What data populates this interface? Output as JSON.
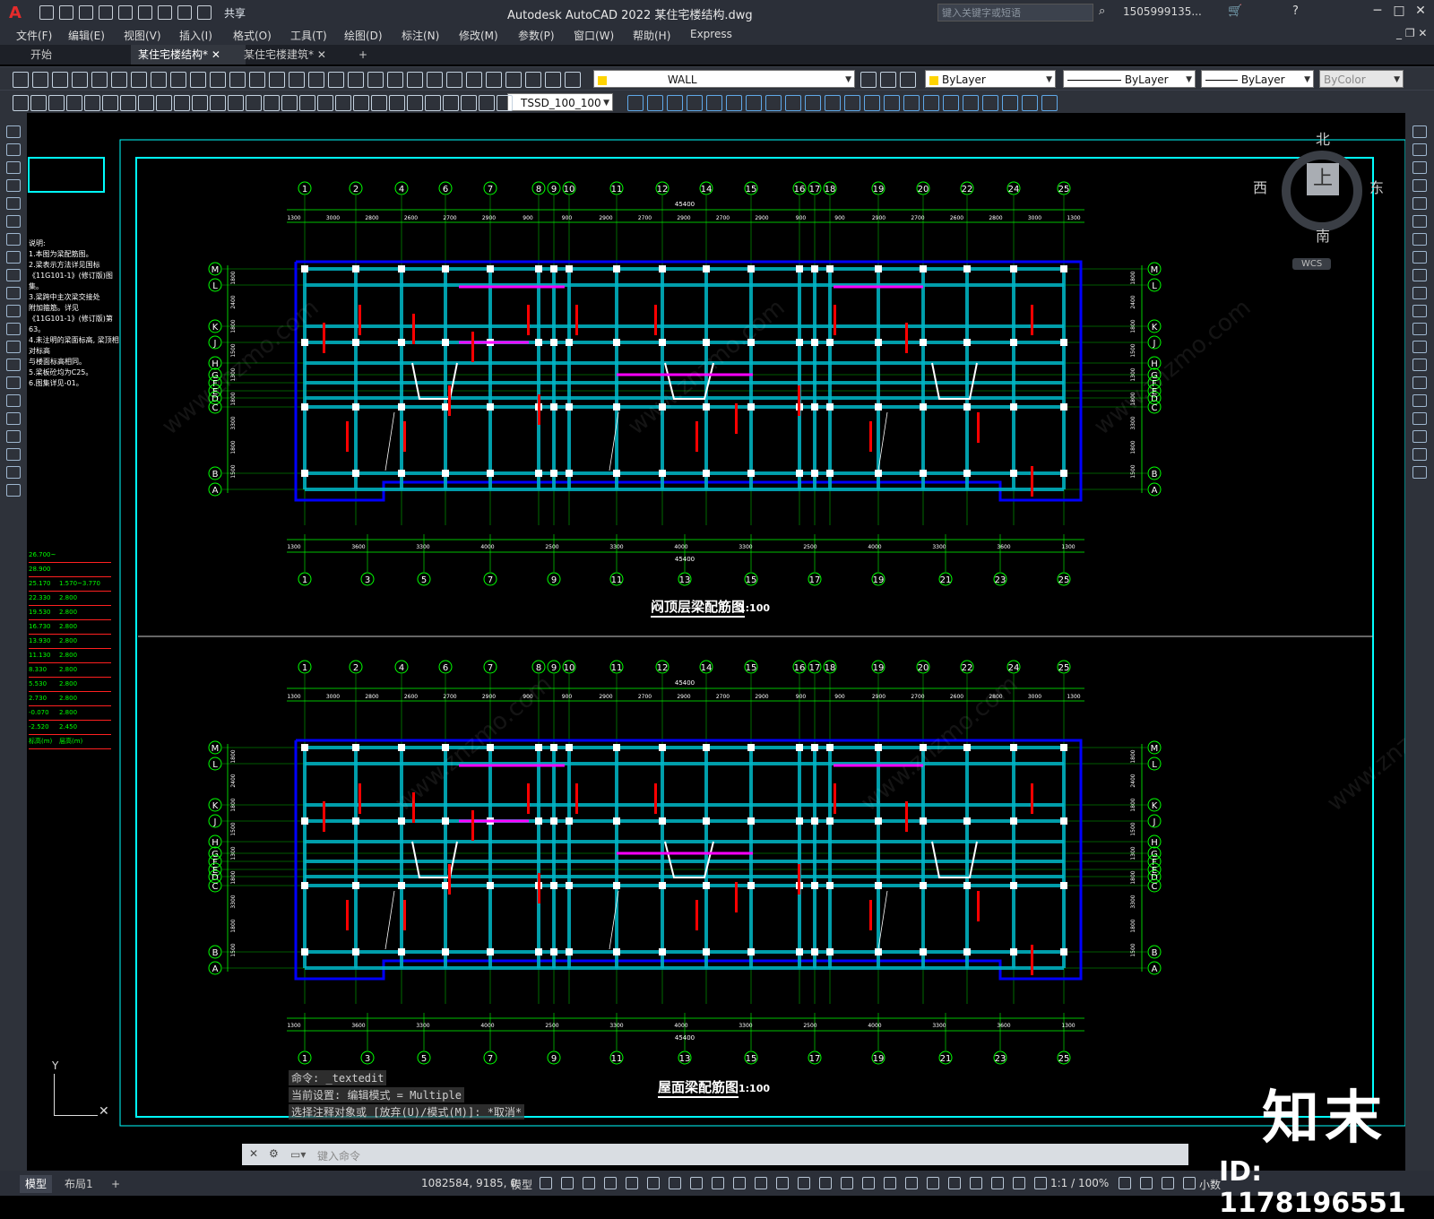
{
  "app": {
    "title": "Autodesk AutoCAD 2022    某住宅楼结构.dwg",
    "share_label": "共享",
    "search_placeholder": "键入关键字或短语",
    "user": "1505999135...",
    "logo": "A"
  },
  "menu": [
    "文件(F)",
    "编辑(E)",
    "视图(V)",
    "插入(I)",
    "格式(O)",
    "工具(T)",
    "绘图(D)",
    "标注(N)",
    "修改(M)",
    "参数(P)",
    "窗口(W)",
    "帮助(H)",
    "Express"
  ],
  "tabs": [
    {
      "label": "开始",
      "active": false
    },
    {
      "label": "某住宅楼结构*",
      "active": true
    },
    {
      "label": "某住宅楼建筑*",
      "active": false
    },
    {
      "label": "+",
      "active": false
    }
  ],
  "toolbar": {
    "layer": "WALL",
    "color": "ByLayer",
    "linetype": "ByLayer",
    "lineweight": "ByLayer",
    "plotstyle": "ByColor",
    "textstyle": "TSSD_100_100"
  },
  "viewcube": {
    "north": "北",
    "south": "南",
    "east": "东",
    "west": "西",
    "top": "上",
    "wcs": "WCS"
  },
  "drawing": {
    "plan1_title": "闷顶层梁配筋图",
    "plan2_title": "屋面梁配筋图",
    "scale": "1:100",
    "total_dim": "45400",
    "top_axes": [
      "1",
      "2",
      "4",
      "6",
      "7",
      "8",
      "9",
      "10",
      "11",
      "12",
      "14",
      "15",
      "16",
      "17",
      "18",
      "19",
      "20",
      "22",
      "24",
      "25"
    ],
    "bottom_axes": [
      "1",
      "3",
      "5",
      "7",
      "9",
      "11",
      "13",
      "15",
      "17",
      "19",
      "21",
      "23",
      "25"
    ],
    "row_axes": [
      "M",
      "L",
      "K",
      "J",
      "H",
      "G",
      "F",
      "E",
      "D",
      "C",
      "B",
      "A"
    ],
    "top_dims": [
      "1300",
      "3000",
      "2800",
      "2600",
      "2700",
      "2900",
      "900",
      "900",
      "2900",
      "2700",
      "2900",
      "2700",
      "2900",
      "900",
      "900",
      "2900",
      "2700",
      "2600",
      "2800",
      "3000",
      "1300"
    ],
    "bottom_dims": [
      "1300",
      "3600",
      "3300",
      "4000",
      "2500",
      "3300",
      "4000",
      "3300",
      "2500",
      "4000",
      "3300",
      "3600",
      "1300"
    ],
    "side_dims": [
      "1800",
      "2400",
      "1800",
      "1500",
      "1300",
      "1800",
      "3300",
      "1800",
      "1500"
    ],
    "level_table": [
      [
        "26.700~",
        ""
      ],
      [
        "28.900",
        ""
      ],
      [
        "25.170",
        "1.570~3.770"
      ],
      [
        "22.330",
        "2.800"
      ],
      [
        "19.530",
        "2.800"
      ],
      [
        "16.730",
        "2.800"
      ],
      [
        "13.930",
        "2.800"
      ],
      [
        "11.130",
        "2.800"
      ],
      [
        "8.330",
        "2.800"
      ],
      [
        "5.530",
        "2.800"
      ],
      [
        "2.730",
        "2.800"
      ],
      [
        "-0.070",
        "2.800"
      ],
      [
        "-2.520",
        "2.450"
      ],
      [
        "标高(m)",
        "层高(m)"
      ]
    ],
    "note_lines": [
      "说明:",
      "1.本图为梁配筋图。",
      "2.梁表示方法详见国标",
      "  《11G101-1》(修订版)图集。",
      "3.梁跨中主次梁交接处",
      "  附加箍筋。详见",
      "  《11G101-1》(修订版)第63。",
      "4.未注明的梁面标高, 梁顶相对标高",
      "  与楼面标高相同。",
      "5.梁板砼均为C25。",
      "6.图集详见-01。"
    ]
  },
  "command": {
    "history": [
      "命令: _textedit",
      "当前设置: 编辑模式 = Multiple",
      "选择注释对象或 [放弃(U)/模式(M)]: *取消*"
    ],
    "input_placeholder": "键入命令"
  },
  "status": {
    "layout_tabs": [
      "模型",
      "布局1",
      "+"
    ],
    "coords": "1082584, 9185, 0",
    "model": "模型",
    "scale": "1:1 / 100%",
    "units": "小数"
  },
  "watermark": {
    "brand": "知末",
    "id": "ID: 1178196551",
    "site": "www.znzmo.com"
  },
  "colors": {
    "background": "#000000",
    "axis_green": "#00ff00",
    "beam_cyan": "#00b4c8",
    "wall_blue": "#0000ff",
    "red_text": "#ff0000",
    "frame_cyan": "#00ffff",
    "magenta": "#ff00ff"
  }
}
